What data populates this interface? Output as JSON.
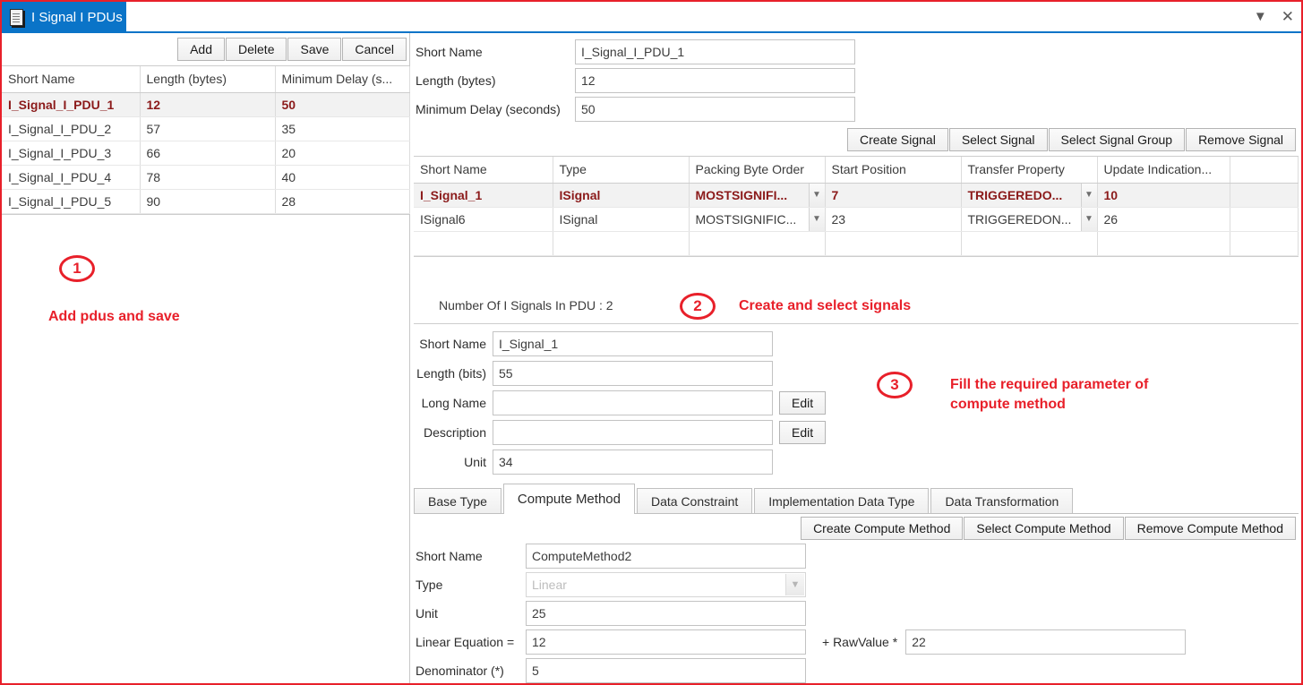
{
  "window": {
    "tab_title": "I Signal I PDUs",
    "doc_icon": "document-icon",
    "minimize_icon": "chevron-down-icon",
    "close_icon": "close-icon",
    "accent_color": "#0a74c8",
    "annotation_color": "#e8202a",
    "selected_row_color": "#8b1a1a"
  },
  "left_panel": {
    "toolbar": {
      "add": "Add",
      "delete": "Delete",
      "save": "Save",
      "cancel": "Cancel"
    },
    "table": {
      "columns": [
        "Short Name",
        "Length (bytes)",
        "Minimum Delay (s..."
      ],
      "rows": [
        {
          "short_name": "I_Signal_I_PDU_1",
          "length": "12",
          "min_delay": "50",
          "selected": true
        },
        {
          "short_name": "I_Signal_I_PDU_2",
          "length": "57",
          "min_delay": "35",
          "selected": false
        },
        {
          "short_name": "I_Signal_I_PDU_3",
          "length": "66",
          "min_delay": "20",
          "selected": false
        },
        {
          "short_name": "I_Signal_I_PDU_4",
          "length": "78",
          "min_delay": "40",
          "selected": false
        },
        {
          "short_name": "I_Signal_I_PDU_5",
          "length": "90",
          "min_delay": "28",
          "selected": false
        }
      ]
    },
    "annotation": {
      "number": "1",
      "text": "Add pdus and save"
    }
  },
  "right_panel": {
    "pdu_form": {
      "short_name_label": "Short Name",
      "short_name_value": "I_Signal_I_PDU_1",
      "length_label": "Length (bytes)",
      "length_value": "12",
      "min_delay_label": "Minimum Delay (seconds)",
      "min_delay_value": "50"
    },
    "signal_buttons": {
      "create": "Create Signal",
      "select": "Select Signal",
      "select_group": "Select Signal Group",
      "remove": "Remove Signal"
    },
    "signal_table": {
      "columns": [
        "Short Name",
        "Type",
        "Packing Byte Order",
        "Start Position",
        "Transfer Property",
        "Update Indication...",
        ""
      ],
      "rows": [
        {
          "short_name": "I_Signal_1",
          "type": "ISignal",
          "packing_byte_order": "MOSTSIGNIFI...",
          "start_position": "7",
          "transfer_property": "TRIGGEREDO...",
          "update_indication": "10",
          "selected": true
        },
        {
          "short_name": "ISignal6",
          "type": "ISignal",
          "packing_byte_order": "MOSTSIGNIFIC...",
          "start_position": "23",
          "transfer_property": "TRIGGEREDON...",
          "update_indication": "26",
          "selected": false
        }
      ]
    },
    "status": {
      "text": "Number Of I Signals In PDU : 2"
    },
    "annotation_2": {
      "number": "2",
      "text": "Create and select signals"
    },
    "annotation_3": {
      "number": "3",
      "line1": "Fill the required parameter of",
      "line2": "compute method"
    },
    "signal_form": {
      "short_name_label": "Short Name",
      "short_name_value": "I_Signal_1",
      "length_label": "Length (bits)",
      "length_value": "55",
      "long_name_label": "Long Name",
      "long_name_value": "",
      "long_name_edit": "Edit",
      "description_label": "Description",
      "description_value": "",
      "description_edit": "Edit",
      "unit_label": "Unit",
      "unit_value": "34"
    },
    "tabs": [
      {
        "label": "Base Type",
        "active": false
      },
      {
        "label": "Compute Method",
        "active": true
      },
      {
        "label": "Data Constraint",
        "active": false
      },
      {
        "label": "Implementation Data Type",
        "active": false
      },
      {
        "label": "Data Transformation",
        "active": false
      }
    ],
    "compute_method_buttons": {
      "create": "Create Compute Method",
      "select": "Select Compute Method",
      "remove": "Remove Compute Method"
    },
    "compute_method_form": {
      "short_name_label": "Short Name",
      "short_name_value": "ComputeMethod2",
      "type_label": "Type",
      "type_value": "Linear",
      "unit_label": "Unit",
      "unit_value": "25",
      "linear_equation_label": "Linear Equation =",
      "linear_equation_value": "12",
      "raw_value_label": "+ RawValue *",
      "raw_value_value": "22",
      "denominator_label": "Denominator (*)",
      "denominator_value": "5"
    }
  }
}
